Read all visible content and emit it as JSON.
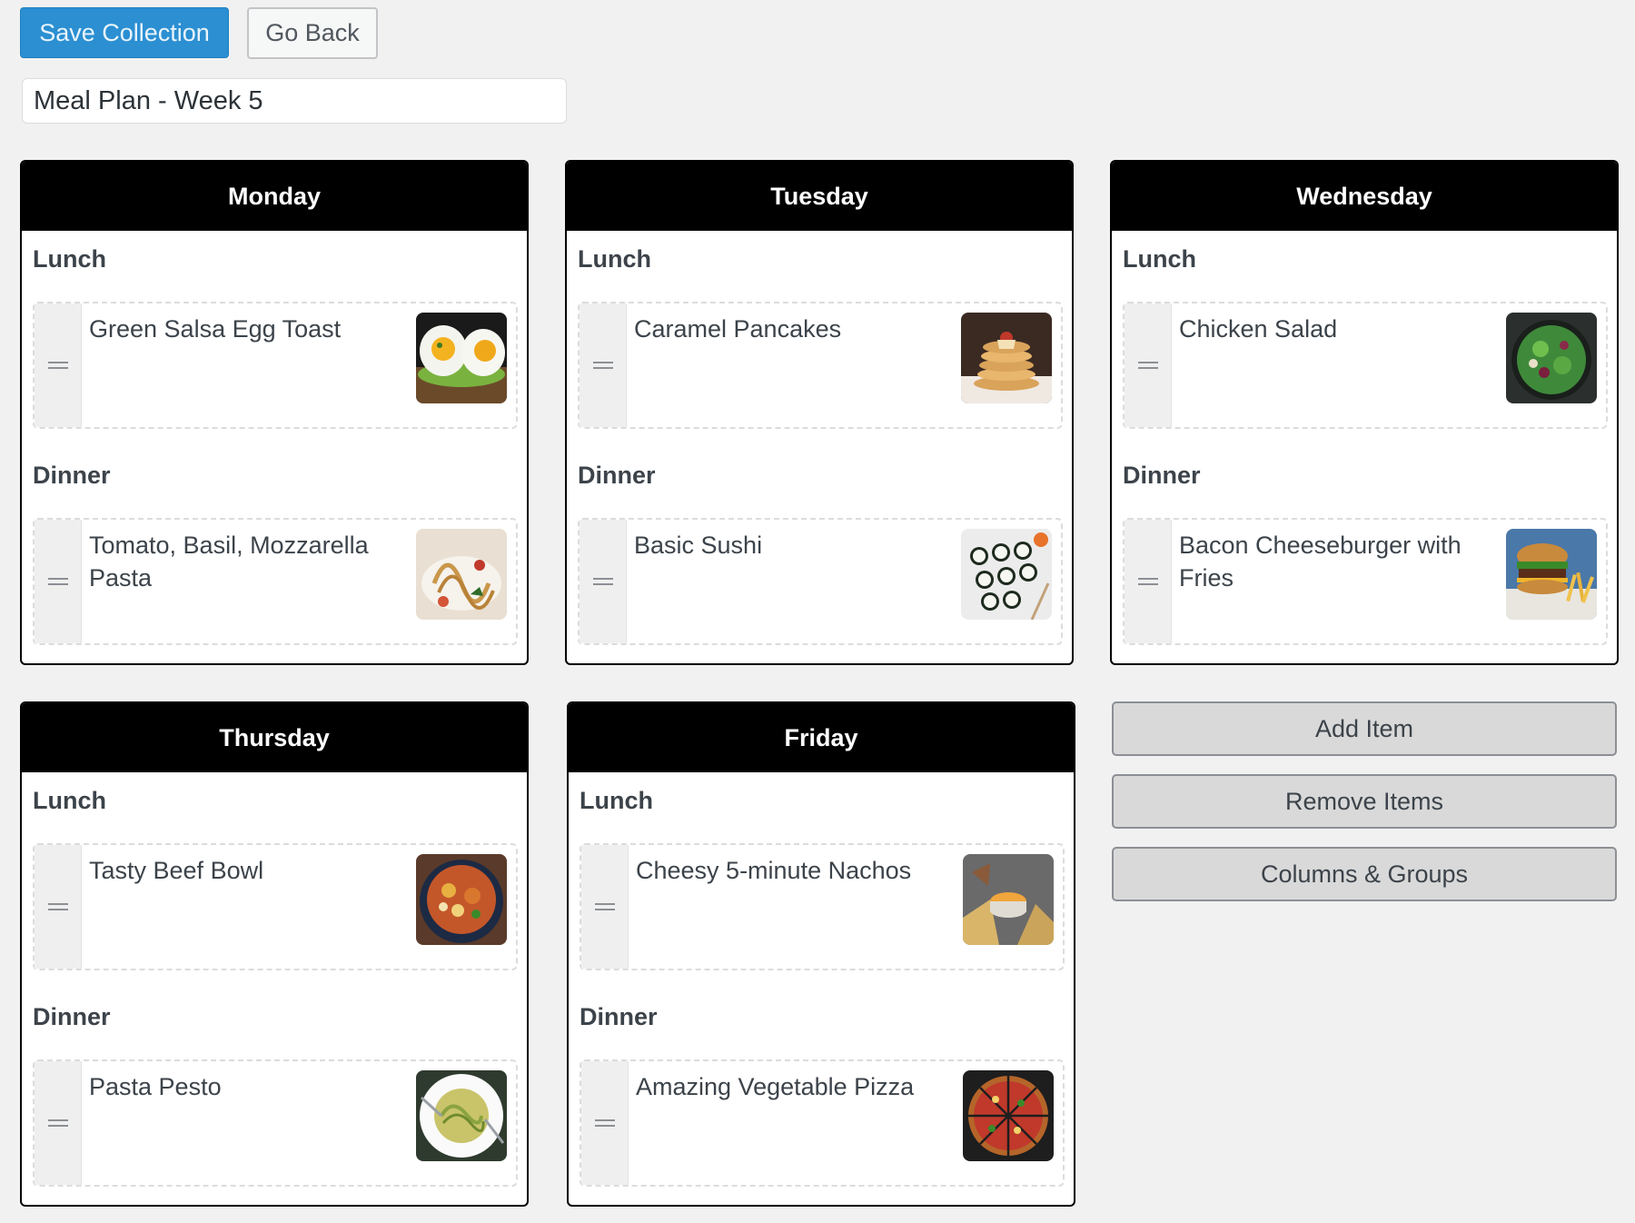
{
  "toolbar": {
    "save_label": "Save Collection",
    "back_label": "Go Back"
  },
  "collection": {
    "title": "Meal Plan - Week 5"
  },
  "days": [
    {
      "name": "Monday",
      "groups": [
        {
          "label": "Lunch",
          "item": "Green Salsa Egg Toast",
          "image": "egg-toast-photo"
        },
        {
          "label": "Dinner",
          "item": "Tomato, Basil, Mozzarella Pasta",
          "image": "pasta-photo"
        }
      ]
    },
    {
      "name": "Tuesday",
      "groups": [
        {
          "label": "Lunch",
          "item": "Caramel Pancakes",
          "image": "pancakes-photo"
        },
        {
          "label": "Dinner",
          "item": "Basic Sushi",
          "image": "sushi-photo"
        }
      ]
    },
    {
      "name": "Wednesday",
      "groups": [
        {
          "label": "Lunch",
          "item": "Chicken Salad",
          "image": "salad-photo"
        },
        {
          "label": "Dinner",
          "item": "Bacon Cheeseburger with Fries",
          "image": "burger-photo"
        }
      ]
    },
    {
      "name": "Thursday",
      "groups": [
        {
          "label": "Lunch",
          "item": "Tasty Beef Bowl",
          "image": "beef-bowl-photo"
        },
        {
          "label": "Dinner",
          "item": "Pasta Pesto",
          "image": "pesto-photo"
        }
      ]
    },
    {
      "name": "Friday",
      "groups": [
        {
          "label": "Lunch",
          "item": "Cheesy 5-minute Nachos",
          "image": "nachos-photo"
        },
        {
          "label": "Dinner",
          "item": "Amazing Vegetable Pizza",
          "image": "pizza-photo"
        }
      ]
    }
  ],
  "actions": {
    "add_label": "Add Item",
    "remove_label": "Remove Items",
    "columns_label": "Columns & Groups"
  },
  "colors": {
    "primary_button": "#2b8fd2",
    "card_header": "#000000",
    "background": "#f1f1f1"
  }
}
